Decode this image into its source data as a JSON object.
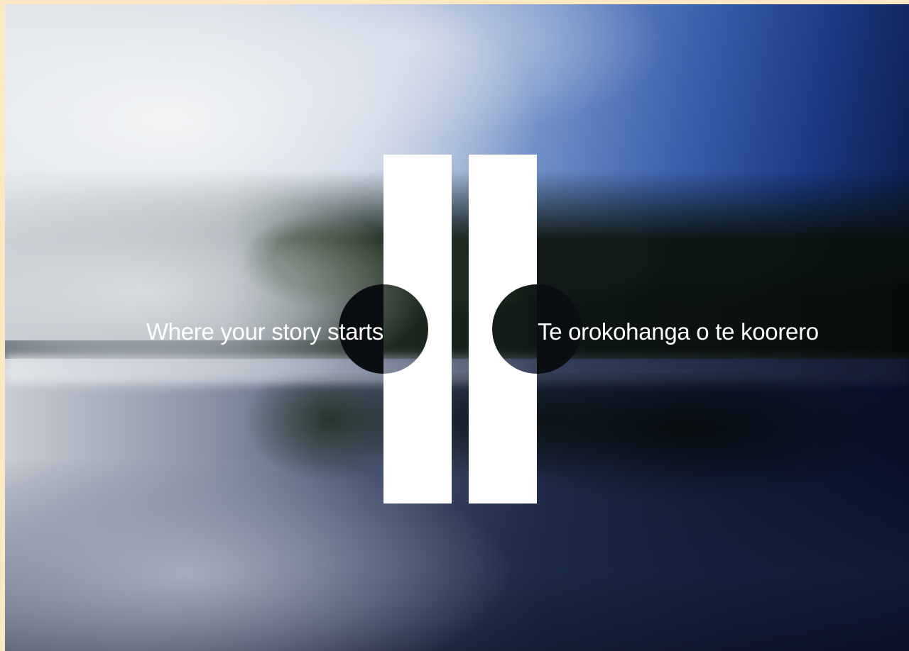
{
  "hero": {
    "tagline_english": "Where your story starts",
    "tagline_maori": "Te orokohanga o te koorero"
  },
  "logo": {
    "icon": "twin-pillars-logo-icon",
    "color": "#ffffff"
  },
  "colors": {
    "frame": "#fde8c4",
    "sky_light": "#dfe2e6",
    "sky_blue": "#3d63ae",
    "water_dark": "#081028"
  }
}
